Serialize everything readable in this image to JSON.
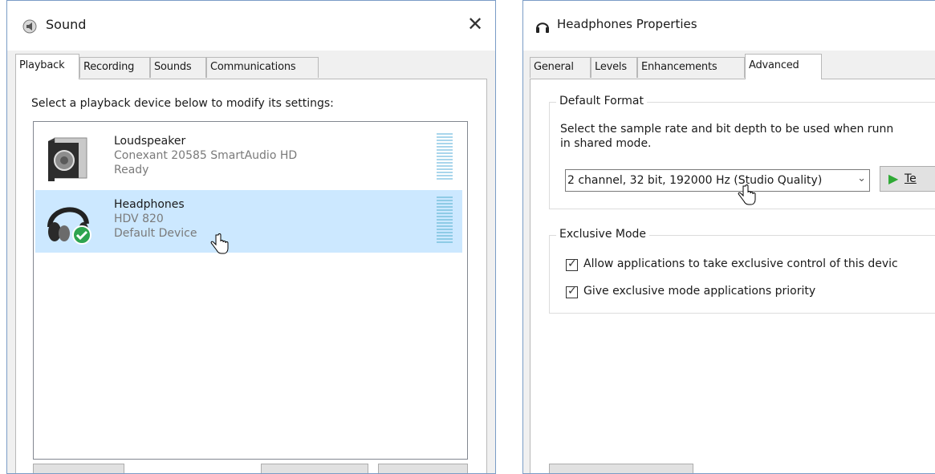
{
  "sound_window": {
    "title": "Sound",
    "close_glyph": "✕",
    "tabs": [
      {
        "label": "Playback",
        "active": true
      },
      {
        "label": "Recording",
        "active": false
      },
      {
        "label": "Sounds",
        "active": false
      },
      {
        "label": "Communications",
        "active": false
      }
    ],
    "instruction": "Select a playback device below to modify its settings:",
    "devices": [
      {
        "name": "Loudspeaker",
        "driver": "Conexant 20585 SmartAudio HD",
        "status": "Ready",
        "icon": "speaker-icon",
        "selected": false
      },
      {
        "name": "Headphones",
        "driver": "HDV 820",
        "status": "Default Device",
        "icon": "headphones-icon",
        "badge": "green-check-icon",
        "selected": true
      }
    ]
  },
  "properties_window": {
    "title": "Headphones Properties",
    "tabs": [
      {
        "label": "General",
        "active": false
      },
      {
        "label": "Levels",
        "active": false
      },
      {
        "label": "Enhancements",
        "active": false
      },
      {
        "label": "Advanced",
        "active": true
      }
    ],
    "default_format": {
      "group_label": "Default Format",
      "description_line1": "Select the sample rate and bit depth to be used when runn",
      "description_line2": "in shared mode.",
      "selected_format": "2 channel, 32 bit, 192000 Hz (Studio Quality)",
      "test_button": "Te"
    },
    "exclusive_mode": {
      "group_label": "Exclusive Mode",
      "options": [
        {
          "label": "Allow applications to take exclusive control of this devic",
          "checked": true
        },
        {
          "label": "Give exclusive mode applications priority",
          "checked": true
        }
      ]
    }
  },
  "colors": {
    "selection": "#cce8ff",
    "window_border": "#7a9cc6",
    "play_green": "#2fa935",
    "check_green": "#2ea44f"
  }
}
